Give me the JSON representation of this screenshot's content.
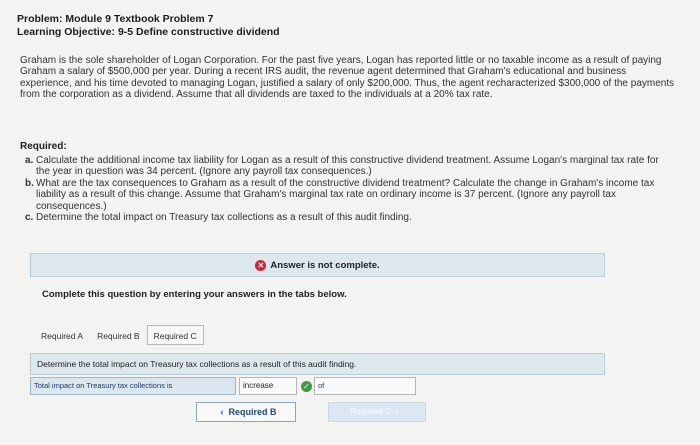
{
  "header": {
    "title": "Problem: Module 9 Textbook Problem 7",
    "objective": "Learning Objective: 9-5 Define constructive dividend"
  },
  "problem_text": "Graham is the sole shareholder of Logan Corporation. For the past five years, Logan has reported little or no taxable income as a result of paying Graham a salary of $500,000 per year. During a recent IRS audit, the revenue agent determined that Graham's educational and business experience, and his time devoted to managing Logan, justified a salary of only $200,000. Thus, the agent recharacterized $300,000 of the payments from the corporation as a dividend. Assume that all dividends are taxed to the individuals at a 20% tax rate.",
  "required": {
    "heading": "Required:",
    "items": [
      {
        "letter": "a.",
        "text": "Calculate the additional income tax liability for Logan as a result of this constructive dividend treatment. Assume Logan's marginal tax rate for the year in question was 34 percent. (Ignore any payroll tax consequences.)"
      },
      {
        "letter": "b.",
        "text": "What are the tax consequences to Graham as a result of the constructive dividend treatment? Calculate the change in Graham's income tax liability as a result of this change. Assume that Graham's marginal tax rate on ordinary income is 37 percent. (Ignore any payroll tax consequences.)"
      },
      {
        "letter": "c.",
        "text": "Determine the total impact on Treasury tax collections as a result of this audit finding."
      }
    ]
  },
  "status": {
    "icon": "x-circle-icon",
    "text": "Answer is not complete."
  },
  "instructions": "Complete this question by entering your answers in the tabs below.",
  "tabs": [
    {
      "label": "Required A"
    },
    {
      "label": "Required B"
    },
    {
      "label": "Required C"
    }
  ],
  "active_tab": "Required C",
  "question": "Determine the total impact on Treasury tax collections as a result of this audit finding.",
  "answer": {
    "label": "Total impact on Treasury tax collections is",
    "selected_value": "increase",
    "check_icon": "check-circle-icon",
    "input_value": "of"
  },
  "navigation": {
    "prev_label": "Required B",
    "next_label": "Required C"
  },
  "colors": {
    "banner_bg": "#dde7ee",
    "error_red": "#c8283a",
    "correct_green": "#3e9a46",
    "link_blue": "#1e4a85"
  }
}
